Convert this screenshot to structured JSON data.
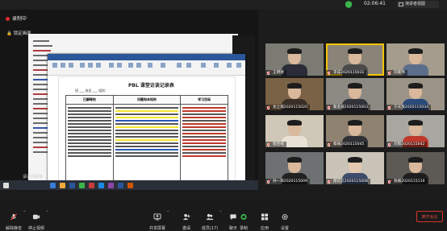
{
  "topbar": {
    "time": "02:06:41",
    "view_mode": "演讲者视图"
  },
  "recording": {
    "label": "录制中"
  },
  "lock": {
    "label": "锁定画面"
  },
  "document": {
    "title": "PBL 课堂访谈记录表",
    "meta": "班 ___ 成员 ___      组别：",
    "headers": [
      "已解释的",
      "问题和未知的",
      "学习目标"
    ]
  },
  "video_label": "请访问链接",
  "participants": [
    {
      "name": "王明德"
    },
    {
      "name": "李成2020115031"
    },
    {
      "name": "刘嘉伟"
    },
    {
      "name": "龙之楠2020115020"
    },
    {
      "name": "甄金坡2020115003"
    },
    {
      "name": "宁天放2020115034"
    },
    {
      "name": "程佳绘"
    },
    {
      "name": "蔡绮2020115045"
    },
    {
      "name": "刘雨2020115042"
    },
    {
      "name": "孙一菲2020115009"
    },
    {
      "name": "郁冠云2020115008"
    },
    {
      "name": "张楠2020115119"
    }
  ],
  "toolbar": {
    "buttons": [
      {
        "label": "解除静音"
      },
      {
        "label": "停止视频"
      },
      {
        "label": "共享屏幕"
      },
      {
        "label": "邀请"
      },
      {
        "label": "成员(17)"
      },
      {
        "label": "聊天"
      },
      {
        "label": "录制"
      },
      {
        "label": "应用"
      },
      {
        "label": "设置"
      }
    ],
    "leave": "离开会议"
  },
  "colors": {
    "accent": "#f5c400",
    "leave": "#e3443a",
    "recording": "#e02929"
  }
}
